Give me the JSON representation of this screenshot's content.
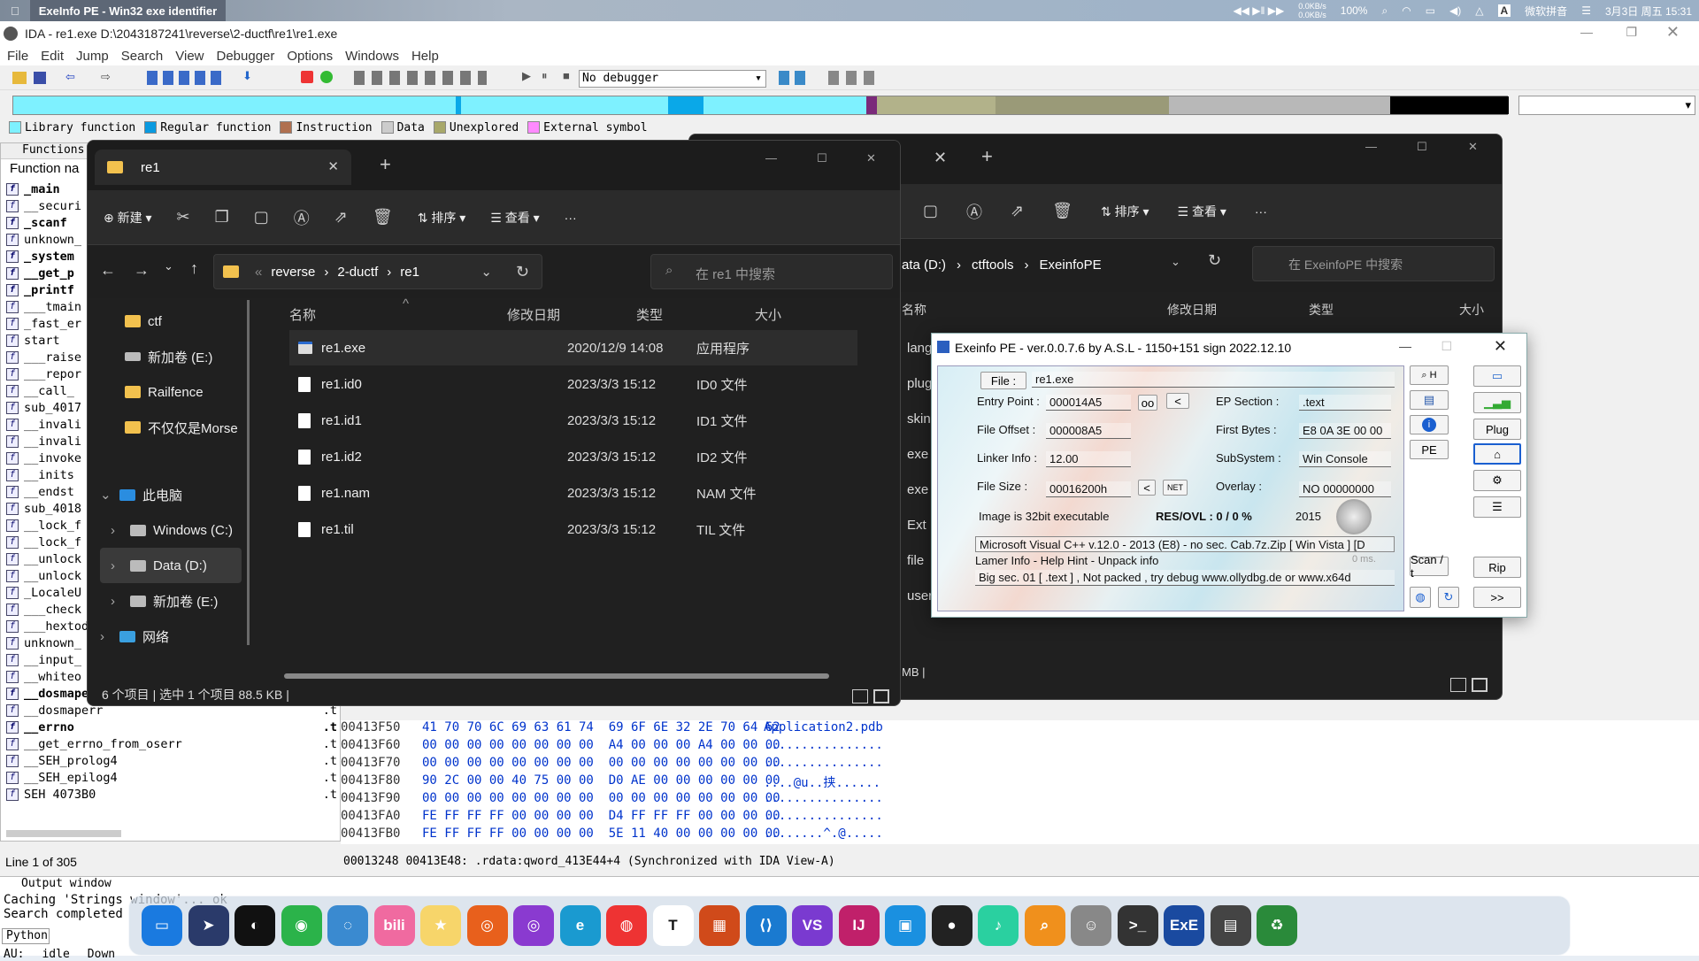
{
  "mac_menubar": {
    "app_title": "ExeInfo PE - Win32 exe identifier",
    "net_up": "0.0KB/s",
    "net_down": "0.0KB/s",
    "battery": "100%",
    "ime": "微软拼音",
    "datetime": "3月3日 周五 15:31"
  },
  "ida": {
    "title": "IDA - re1.exe D:\\2043187241\\reverse\\2-ductf\\re1\\re1.exe",
    "menu": [
      "File",
      "Edit",
      "Jump",
      "Search",
      "View",
      "Debugger",
      "Options",
      "Windows",
      "Help"
    ],
    "debugger_select": "No debugger",
    "legend": [
      "Library function",
      "Regular function",
      "Instruction",
      "Data",
      "Unexplored",
      "External symbol"
    ],
    "functions_tab": "Functions",
    "functions_header": "Function na",
    "functions": [
      {
        "name": "_main",
        "bold": true
      },
      {
        "name": "__securi",
        "bold": false
      },
      {
        "name": "_scanf",
        "bold": true
      },
      {
        "name": "unknown_",
        "bold": false
      },
      {
        "name": "_system",
        "bold": true
      },
      {
        "name": "__get_p",
        "bold": true
      },
      {
        "name": "_printf",
        "bold": true
      },
      {
        "name": "___tmain",
        "bold": false
      },
      {
        "name": "_fast_er",
        "bold": false
      },
      {
        "name": "start",
        "bold": false
      },
      {
        "name": "___raise",
        "bold": false
      },
      {
        "name": "___repor",
        "bold": false
      },
      {
        "name": "__call_",
        "bold": false
      },
      {
        "name": "sub_4017",
        "bold": false
      },
      {
        "name": "__invali",
        "bold": false
      },
      {
        "name": "__invali",
        "bold": false
      },
      {
        "name": "__invoke",
        "bold": false
      },
      {
        "name": "__inits",
        "bold": false
      },
      {
        "name": "__endst",
        "bold": false
      },
      {
        "name": "sub_4018",
        "bold": false
      },
      {
        "name": "__lock_f",
        "bold": false
      },
      {
        "name": "__lock_f",
        "bold": false
      },
      {
        "name": "__unlock",
        "bold": false
      },
      {
        "name": "__unlock",
        "bold": false
      },
      {
        "name": "_LocaleU",
        "bold": false
      },
      {
        "name": "___check",
        "bold": false
      },
      {
        "name": "___hextod",
        "bold": false
      },
      {
        "name": "unknown_",
        "bold": false
      },
      {
        "name": "__input_",
        "bold": false
      },
      {
        "name": "__whiteo",
        "bold": false
      },
      {
        "name": "__dosmaperr",
        "bold": true,
        "seg": ".t"
      },
      {
        "name": "__dosmaperr",
        "bold": false,
        "seg": ".t"
      },
      {
        "name": "__errno",
        "bold": true,
        "seg": ".t"
      },
      {
        "name": "__get_errno_from_oserr",
        "bold": false,
        "seg": ".t"
      },
      {
        "name": "__SEH_prolog4",
        "bold": false,
        "seg": ".t"
      },
      {
        "name": "__SEH_epilog4",
        "bold": false,
        "seg": ".t"
      },
      {
        "name": "SEH 4073B0",
        "bold": false,
        "seg": ".t"
      }
    ],
    "hex_rows": [
      {
        "addr": "00413F50",
        "bytes": "41 70 70 6C 69 63 61 74  69 6F 6E 32 2E 70 64 62",
        "ascii": "Application2.pdb"
      },
      {
        "addr": "00413F60",
        "bytes": "00 00 00 00 00 00 00 00  A4 00 00 00 A4 00 00 00",
        "ascii": "................"
      },
      {
        "addr": "00413F70",
        "bytes": "00 00 00 00 00 00 00 00  00 00 00 00 00 00 00 00",
        "ascii": "................"
      },
      {
        "addr": "00413F80",
        "bytes": "90 2C 00 00 40 75 00 00  D0 AE 00 00 00 00 00 00",
        "ascii": "....@u..挟......"
      },
      {
        "addr": "00413F90",
        "bytes": "00 00 00 00 00 00 00 00  00 00 00 00 00 00 00 00",
        "ascii": "................"
      },
      {
        "addr": "00413FA0",
        "bytes": "FE FF FF FF 00 00 00 00  D4 FF FF FF 00 00 00 00",
        "ascii": "................"
      },
      {
        "addr": "00413FB0",
        "bytes": "FE FF FF FF 00 00 00 00  5E 11 40 00 00 00 00 00",
        "ascii": "........^.@....."
      }
    ],
    "line_status": "Line 1 of 305",
    "hex_status": "00013248 00413E48: .rdata:qword_413E44+4 (Synchronized with IDA View-A)",
    "output_title": "Output window",
    "output_lines": [
      "Caching 'Strings window'... ok",
      "Search completed"
    ],
    "python_label": "Python",
    "au_status": "AU:",
    "au_idle": "idle",
    "au_down": "Down"
  },
  "explorer1": {
    "tab_title": "re1",
    "new_label": "新建",
    "sort_label": "排序",
    "view_label": "查看",
    "crumbs": [
      "reverse",
      "2-ductf",
      "re1"
    ],
    "search_placeholder": "在 re1 中搜索",
    "nav_items": [
      "ctf",
      "新加卷 (E:)",
      "Railfence",
      "不仅仅是Morse"
    ],
    "tree": [
      "此电脑",
      "Windows (C:)",
      "Data (D:)",
      "新加卷 (E:)",
      "网络"
    ],
    "columns": [
      "名称",
      "修改日期",
      "类型",
      "大小"
    ],
    "files": [
      {
        "name": "re1.exe",
        "date": "2020/12/9 14:08",
        "type": "应用程序"
      },
      {
        "name": "re1.id0",
        "date": "2023/3/3 15:12",
        "type": "ID0 文件"
      },
      {
        "name": "re1.id1",
        "date": "2023/3/3 15:12",
        "type": "ID1 文件"
      },
      {
        "name": "re1.id2",
        "date": "2023/3/3 15:12",
        "type": "ID2 文件"
      },
      {
        "name": "re1.nam",
        "date": "2023/3/3 15:12",
        "type": "NAM 文件"
      },
      {
        "name": "re1.til",
        "date": "2023/3/3 15:12",
        "type": "TIL 文件"
      }
    ],
    "status": "6 个项目  |  选中 1 个项目  88.5 KB  |"
  },
  "explorer2": {
    "sort_label": "排序",
    "view_label": "查看",
    "crumbs": [
      "ata (D:)",
      "ctftools",
      "ExeinfoPE"
    ],
    "search_placeholder": "在 ExeinfoPE 中搜索",
    "columns": [
      "名称",
      "修改日期",
      "类型",
      "大小"
    ],
    "left_items": [
      "lang",
      "plug",
      "skin",
      "exe",
      "exe",
      "Ext",
      "file",
      "user"
    ],
    "status": "MB  |"
  },
  "exeinfo": {
    "title": "Exeinfo PE - ver.0.0.7.6  by A.S.L -  1150+151 sign  2022.12.10",
    "file_label": "File :",
    "file_value": "re1.exe",
    "entry_label": "Entry Point :",
    "entry_value": "000014A5",
    "oo": "oo",
    "lt": "<",
    "ep_label": "EP Section :",
    "ep_value": ".text",
    "offset_label": "File Offset :",
    "offset_value": "000008A5",
    "firstbytes_label": "First Bytes :",
    "firstbytes_value": "E8 0A 3E 00 00",
    "linker_label": "Linker Info :",
    "linker_value": "12.00",
    "subsystem_label": "SubSystem :",
    "subsystem_value": "Win Console",
    "size_label": "File Size :",
    "size_value": "00016200h",
    "net": "NET",
    "overlay_label": "Overlay :",
    "overlay_value": "NO  00000000",
    "bits": "Image is 32bit executable",
    "resovl": "RES/OVL : 0 / 0 %",
    "year": "2015",
    "detect1": "Microsoft Visual C++ v.12.0 - 2013 (E8) - no sec. Cab.7z.Zip [ Win Vista ] [D",
    "lamer": "Lamer Info - Help Hint - Unpack info",
    "ms": "0 ms.",
    "detect2": "Big sec. 01 [ .text ] , Not packed , try debug www.ollydbg.de or www.x64d",
    "plug": "Plug",
    "pe": "PE",
    "scan": "Scan / t",
    "rip": "Rip",
    "next": ">>"
  },
  "dock_apps": [
    "Finder",
    "Launchpad",
    "QQ",
    "WeChat",
    "Chat",
    "bilibili",
    "Notes",
    "Firefox",
    "Firefox Dev",
    "Edge",
    "Chrome",
    "Typora",
    "Office",
    "VS Code",
    "Visual Studio",
    "IntelliJ",
    "Sandbox",
    "OBS",
    "Music",
    "Search",
    "Photo",
    "Terminal",
    "ExE",
    "Screenshot",
    "Trash"
  ]
}
